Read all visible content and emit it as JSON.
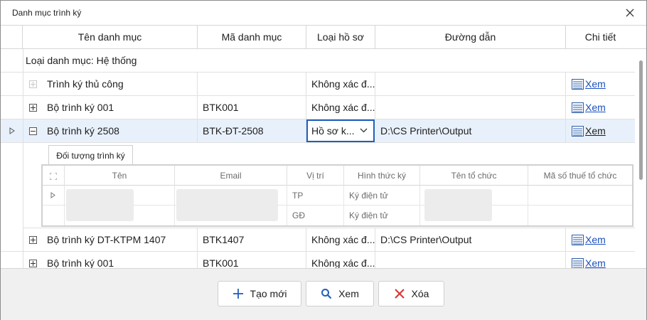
{
  "window": {
    "title": "Danh mục trình ký"
  },
  "columns": {
    "name": "Tên danh mục",
    "code": "Mã danh mục",
    "type": "Loại hồ sơ",
    "path": "Đường dẫn",
    "detail": "Chi tiết"
  },
  "group": {
    "label": "Loại danh mục: Hệ thống"
  },
  "rows": [
    {
      "name": "Trình ký thủ công",
      "code": "",
      "type": "Không xác đ...",
      "path": "",
      "detail": "Xem"
    },
    {
      "name": "Bộ trình ký 001",
      "code": "BTK001",
      "type": "Không xác đ...",
      "path": "",
      "detail": "Xem"
    },
    {
      "name": "Bộ trình ký 2508",
      "code": "BTK-ĐT-2508",
      "type": "Hồ sơ k...",
      "path": "D:\\CS Printer\\Output",
      "detail": "Xem"
    },
    {
      "name": "Bộ trình ký DT-KTPM 1407",
      "code": "BTK1407",
      "type": "Không xác đ...",
      "path": "D:\\CS Printer\\Output",
      "detail": "Xem"
    },
    {
      "name": "Bộ trình ký 001",
      "code": "BTK001",
      "type": "Không xác đ...",
      "path": "",
      "detail": "Xem"
    }
  ],
  "detail_panel": {
    "tab_label": "Đối tượng trình ký",
    "columns": {
      "name": "Tên",
      "email": "Email",
      "position": "Vị trí",
      "sign_method": "Hình thức ký",
      "org_name": "Tên tổ chức",
      "tax_code": "Mã số thuế tổ chức"
    },
    "rows": [
      {
        "position": "TP",
        "sign_method": "Ký điện tử"
      },
      {
        "position": "GĐ",
        "sign_method": "Ký điện tử"
      }
    ]
  },
  "buttons": {
    "create": "Tạo mới",
    "view": "Xem",
    "delete": "Xóa"
  },
  "colors": {
    "accent": "#1f5fbf",
    "link": "#1a4fbf",
    "delete": "#d63a3a",
    "selected_row": "#e8f1fb"
  },
  "icons": [
    "close-icon",
    "plus-icon",
    "search-icon",
    "x-delete-icon",
    "document-icon",
    "chevron-down-icon",
    "row-indicator-icon",
    "expand-icon"
  ]
}
